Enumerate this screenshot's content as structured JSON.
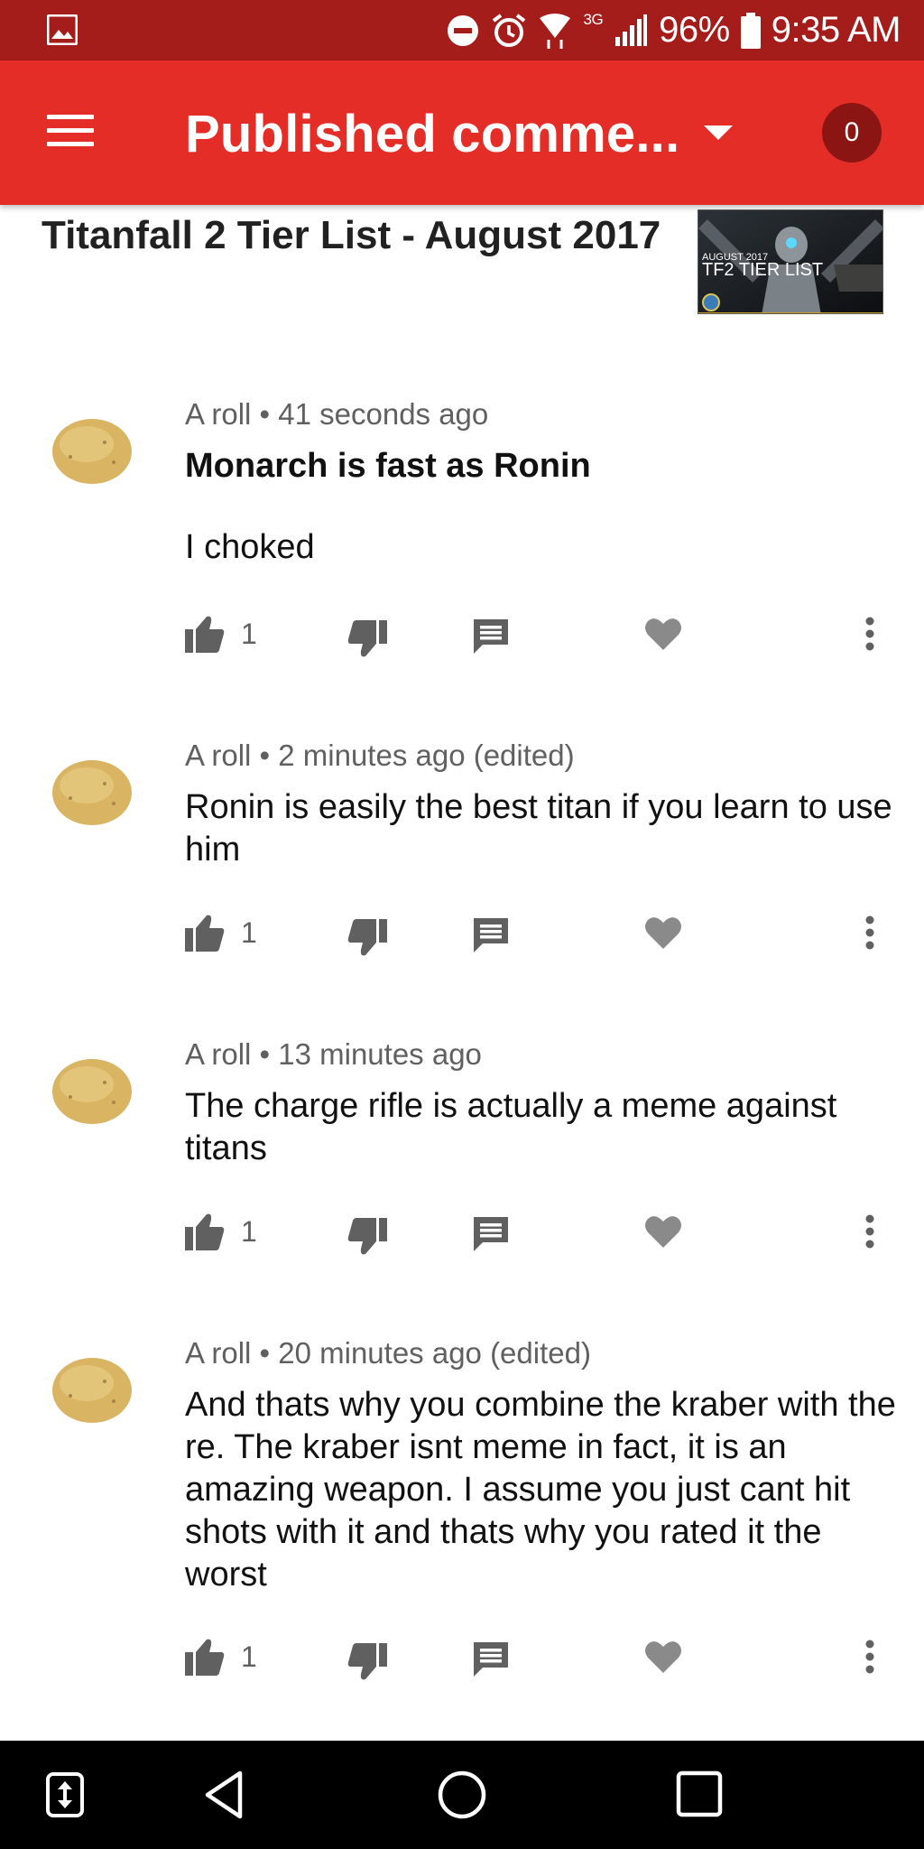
{
  "status_bar": {
    "icons": [
      "gallery-icon",
      "do-not-disturb-icon",
      "alarm-icon",
      "wifi-icon",
      "signal-icon",
      "battery-icon"
    ],
    "network": "3G",
    "battery": "96%",
    "time": "9:35 AM"
  },
  "app_bar": {
    "title": "Published comme...",
    "notification_count": "0"
  },
  "video": {
    "title": "Titanfall 2 Tier List - August 2017",
    "thumbnail_text_small": "AUGUST 2017",
    "thumbnail_text_big": "TF2 TIER LIST"
  },
  "comments": [
    {
      "meta": "A roll • 41 seconds ago",
      "title": "Monarch is fast as Ronin",
      "body": "I choked",
      "likes": "1"
    },
    {
      "meta": "A roll • 2 minutes ago (edited)",
      "title": "",
      "body": "Ronin is easily the best titan if you learn to use him",
      "likes": "1"
    },
    {
      "meta": "A roll • 13 minutes ago",
      "title": "",
      "body": "The charge rifle is actually a meme against titans",
      "likes": "1"
    },
    {
      "meta": "A roll • 20 minutes ago (edited)",
      "title": "",
      "body": "And thats why you combine the kraber with the re. The kraber isnt meme in fact, it is an amazing weapon. I assume you just cant hit shots with it and thats why you rated it the worst",
      "likes": "1"
    }
  ],
  "colors": {
    "status_bar": "#a51d1a",
    "app_bar": "#e52d27",
    "badge": "#8a1512",
    "icon_gray": "#606060"
  }
}
